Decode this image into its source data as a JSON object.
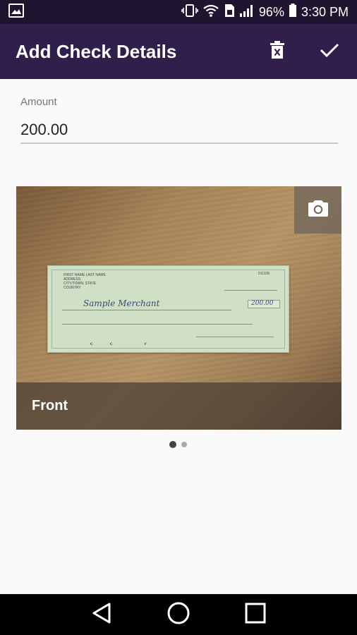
{
  "status_bar": {
    "battery": "96%",
    "time": "3:30 PM"
  },
  "app_bar": {
    "title": "Add Check Details",
    "actions": [
      "delete-icon",
      "check-icon"
    ]
  },
  "form": {
    "amount_label": "Amount",
    "amount_value": "200.00"
  },
  "photo": {
    "caption": "Front",
    "pager": {
      "pages": 2,
      "current": 1
    }
  },
  "colors": {
    "app_bar": "#2f1f4a",
    "status_bar": "#1f1530"
  }
}
